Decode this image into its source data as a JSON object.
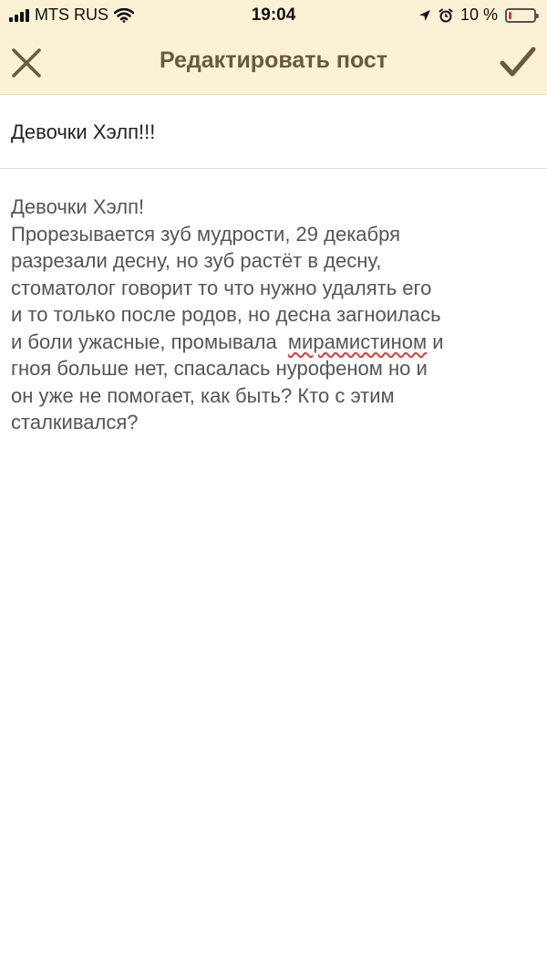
{
  "status_bar": {
    "carrier": "MTS RUS",
    "time": "19:04",
    "battery_percent": "10 %",
    "battery_level": 0.1,
    "battery_color": "#e0342b"
  },
  "nav": {
    "title": "Редактировать пост",
    "close_icon": "close-x-icon",
    "confirm_icon": "checkmark-icon",
    "bar_color": "#fbf1d5",
    "icon_color": "#6a5a3a"
  },
  "post": {
    "title": "Девочки Хэлп!!!",
    "body_before": "Девочки Хэлп!\nПрорезывается зуб мудрости, 29 декабря\nразрезали десну, но зуб растёт в десну,\nстоматолог говорит то что нужно удалять его\nи то только после родов, но десна загноилась\nи боли ужасные, промывала  ",
    "body_misspelled": "мирамистином",
    "body_after": " и\nгноя больше нет, спасалась нурофеном но и\nон уже не помогает, как быть? Кто с этим\nсталкивался?"
  }
}
